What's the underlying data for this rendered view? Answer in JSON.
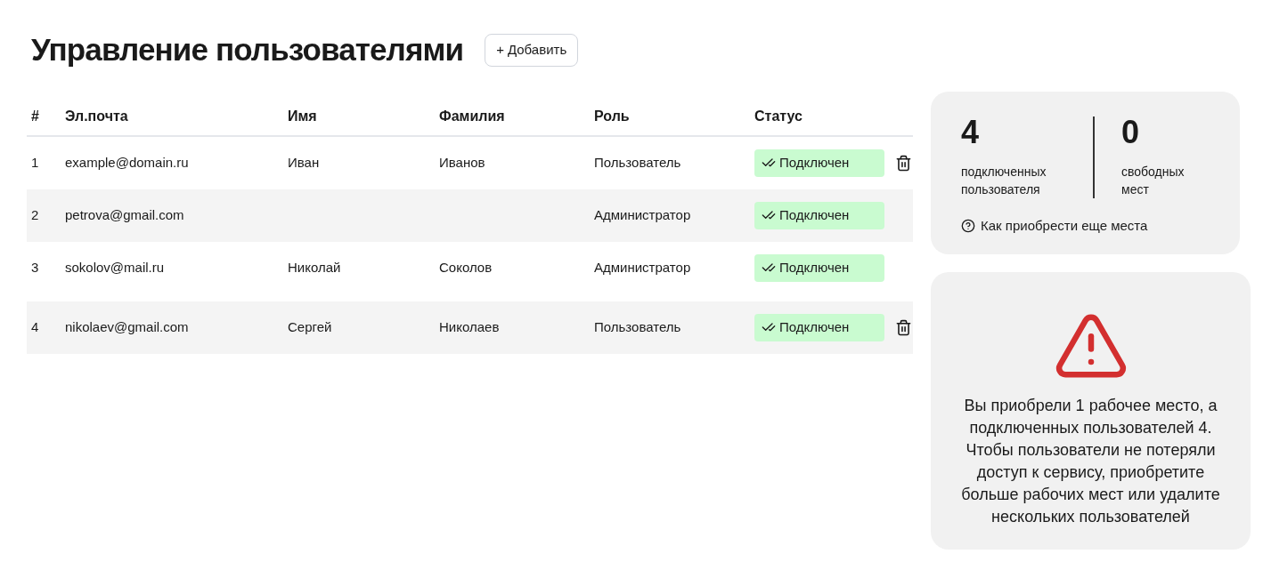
{
  "title": "Управление пользователями",
  "add_button": {
    "icon": "+",
    "label": "Добавить"
  },
  "table": {
    "columns": [
      "#",
      "Эл.почта",
      "Имя",
      "Фамилия",
      "Роль",
      "Статус"
    ],
    "rows": [
      {
        "index": "1",
        "email": "example@domain.ru",
        "first_name": "Иван",
        "last_name": "Иванов",
        "role": "Пользователь",
        "status": "Подключен",
        "shaded": false,
        "deletable": true
      },
      {
        "index": "2",
        "email": "petrova@gmail.com",
        "role": "Администратор",
        "status": "Подключен",
        "shaded": true,
        "deletable": false
      },
      {
        "index": "3",
        "email": "sokolov@mail.ru",
        "first_name": "Николай",
        "last_name": "Соколов",
        "role": "Администратор",
        "status": "Подключен",
        "shaded": false,
        "deletable": false
      },
      {
        "index": "4",
        "email": "nikolaev@gmail.com",
        "first_name": "Сергей",
        "last_name": "Николаев",
        "role": "Пользователь",
        "status": "Подключен",
        "shaded": true,
        "deletable": true
      }
    ]
  },
  "seats_card": {
    "stats": [
      {
        "value": "4",
        "label": "подключенных пользователя"
      },
      {
        "value": "0",
        "label": "свободных мест"
      }
    ],
    "help_link": "Как приобрести еще места"
  },
  "warning_card": {
    "message": "Вы приобрели 1 рабочее место, а подключенных пользователей 4. Чтобы пользователи не потеряли доступ к сервису, приобретите больше рабочих мест или удалите нескольких пользователей"
  }
}
